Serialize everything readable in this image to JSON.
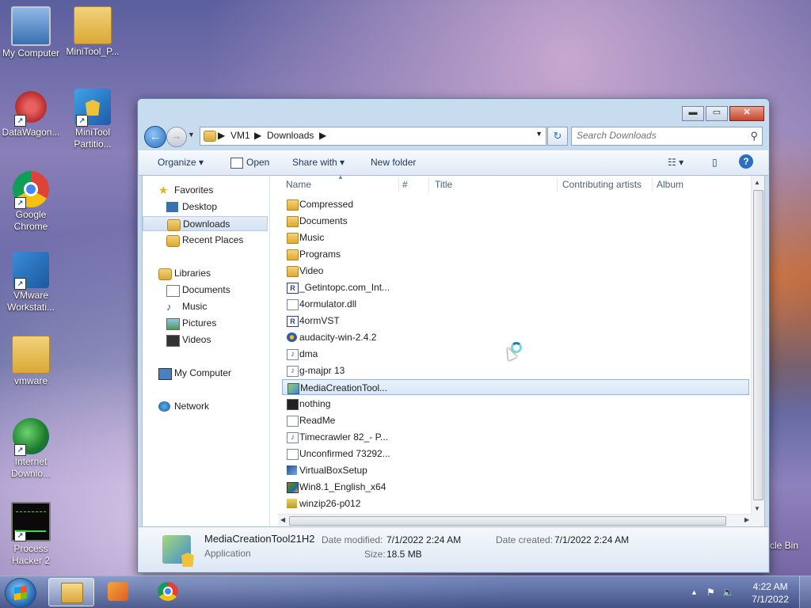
{
  "desktop": {
    "icons": [
      {
        "label": "My Computer",
        "icon": "computer-icon"
      },
      {
        "label": "MiniTool_P...",
        "icon": "folder-icon"
      },
      {
        "label": "DataWagon...",
        "icon": "datawagon-icon"
      },
      {
        "label": "MiniTool Partitio...",
        "icon": "minitool-icon"
      },
      {
        "label": "Google Chrome",
        "icon": "chrome-icon"
      },
      {
        "label": "VMware Workstati...",
        "icon": "vmware-icon"
      },
      {
        "label": "vmware",
        "icon": "folder-icon"
      },
      {
        "label": "Internet Downlo...",
        "icon": "idm-icon"
      },
      {
        "label": "Process Hacker 2",
        "icon": "process-hacker-icon"
      }
    ],
    "recycle_bin_partial": "cle Bin"
  },
  "window": {
    "controls": {
      "minimize": "▬",
      "maximize": "▭",
      "close": "✕"
    },
    "address": {
      "crumbs": [
        "VM1",
        "Downloads"
      ]
    },
    "search": {
      "placeholder": "Search Downloads"
    },
    "toolbar": {
      "organize": "Organize",
      "open": "Open",
      "share_with": "Share with",
      "new_folder": "New folder"
    },
    "nav_pane": {
      "favorites": "Favorites",
      "favorites_items": [
        "Desktop",
        "Downloads",
        "Recent Places"
      ],
      "libraries": "Libraries",
      "libraries_items": [
        "Documents",
        "Music",
        "Pictures",
        "Videos"
      ],
      "computer": "My Computer",
      "network": "Network",
      "selected": "Downloads"
    },
    "columns": [
      "Name",
      "#",
      "Title",
      "Contributing artists",
      "Album"
    ],
    "files": [
      {
        "name": "Compressed",
        "type": "folder"
      },
      {
        "name": "Documents",
        "type": "folder"
      },
      {
        "name": "Music",
        "type": "folder"
      },
      {
        "name": "Programs",
        "type": "folder"
      },
      {
        "name": "Video",
        "type": "folder"
      },
      {
        "name": "_Getintopc.com_Int...",
        "type": "r"
      },
      {
        "name": "4ormulator.dll",
        "type": "file"
      },
      {
        "name": "4ormVST",
        "type": "r"
      },
      {
        "name": "audacity-win-2.4.2",
        "type": "aud"
      },
      {
        "name": "dma",
        "type": "music"
      },
      {
        "name": "g-majpr 13",
        "type": "music"
      },
      {
        "name": "MediaCreationTool...",
        "type": "app",
        "selected": true
      },
      {
        "name": "nothing",
        "type": "term"
      },
      {
        "name": "ReadMe",
        "type": "file"
      },
      {
        "name": "Timecrawler 82_- P...",
        "type": "music"
      },
      {
        "name": "Unconfirmed 73292...",
        "type": "file"
      },
      {
        "name": "VirtualBoxSetup",
        "type": "box"
      },
      {
        "name": "Win8.1_English_x64",
        "type": "win"
      },
      {
        "name": "winzip26-p012",
        "type": "zip"
      }
    ],
    "details": {
      "name": "MediaCreationTool21H2",
      "type": "Application",
      "date_modified_label": "Date modified:",
      "date_modified": "7/1/2022 2:24 AM",
      "size_label": "Size:",
      "size": "18.5 MB",
      "date_created_label": "Date created:",
      "date_created": "7/1/2022 2:24 AM"
    }
  },
  "taskbar": {
    "clock_time": "4:22 AM",
    "clock_date": "7/1/2022"
  }
}
